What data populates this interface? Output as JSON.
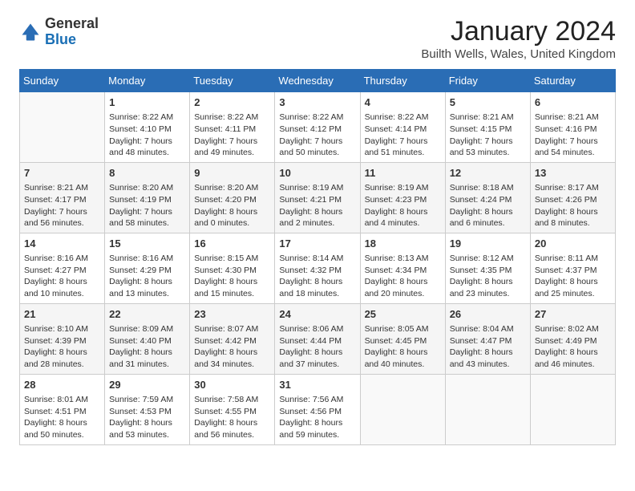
{
  "logo": {
    "general": "General",
    "blue": "Blue"
  },
  "header": {
    "title": "January 2024",
    "subtitle": "Builth Wells, Wales, United Kingdom"
  },
  "weekdays": [
    "Sunday",
    "Monday",
    "Tuesday",
    "Wednesday",
    "Thursday",
    "Friday",
    "Saturday"
  ],
  "weeks": [
    [
      {
        "day": "",
        "empty": true
      },
      {
        "day": "1",
        "sunrise": "Sunrise: 8:22 AM",
        "sunset": "Sunset: 4:10 PM",
        "daylight": "Daylight: 7 hours and 48 minutes."
      },
      {
        "day": "2",
        "sunrise": "Sunrise: 8:22 AM",
        "sunset": "Sunset: 4:11 PM",
        "daylight": "Daylight: 7 hours and 49 minutes."
      },
      {
        "day": "3",
        "sunrise": "Sunrise: 8:22 AM",
        "sunset": "Sunset: 4:12 PM",
        "daylight": "Daylight: 7 hours and 50 minutes."
      },
      {
        "day": "4",
        "sunrise": "Sunrise: 8:22 AM",
        "sunset": "Sunset: 4:14 PM",
        "daylight": "Daylight: 7 hours and 51 minutes."
      },
      {
        "day": "5",
        "sunrise": "Sunrise: 8:21 AM",
        "sunset": "Sunset: 4:15 PM",
        "daylight": "Daylight: 7 hours and 53 minutes."
      },
      {
        "day": "6",
        "sunrise": "Sunrise: 8:21 AM",
        "sunset": "Sunset: 4:16 PM",
        "daylight": "Daylight: 7 hours and 54 minutes."
      }
    ],
    [
      {
        "day": "7",
        "sunrise": "Sunrise: 8:21 AM",
        "sunset": "Sunset: 4:17 PM",
        "daylight": "Daylight: 7 hours and 56 minutes."
      },
      {
        "day": "8",
        "sunrise": "Sunrise: 8:20 AM",
        "sunset": "Sunset: 4:19 PM",
        "daylight": "Daylight: 7 hours and 58 minutes."
      },
      {
        "day": "9",
        "sunrise": "Sunrise: 8:20 AM",
        "sunset": "Sunset: 4:20 PM",
        "daylight": "Daylight: 8 hours and 0 minutes."
      },
      {
        "day": "10",
        "sunrise": "Sunrise: 8:19 AM",
        "sunset": "Sunset: 4:21 PM",
        "daylight": "Daylight: 8 hours and 2 minutes."
      },
      {
        "day": "11",
        "sunrise": "Sunrise: 8:19 AM",
        "sunset": "Sunset: 4:23 PM",
        "daylight": "Daylight: 8 hours and 4 minutes."
      },
      {
        "day": "12",
        "sunrise": "Sunrise: 8:18 AM",
        "sunset": "Sunset: 4:24 PM",
        "daylight": "Daylight: 8 hours and 6 minutes."
      },
      {
        "day": "13",
        "sunrise": "Sunrise: 8:17 AM",
        "sunset": "Sunset: 4:26 PM",
        "daylight": "Daylight: 8 hours and 8 minutes."
      }
    ],
    [
      {
        "day": "14",
        "sunrise": "Sunrise: 8:16 AM",
        "sunset": "Sunset: 4:27 PM",
        "daylight": "Daylight: 8 hours and 10 minutes."
      },
      {
        "day": "15",
        "sunrise": "Sunrise: 8:16 AM",
        "sunset": "Sunset: 4:29 PM",
        "daylight": "Daylight: 8 hours and 13 minutes."
      },
      {
        "day": "16",
        "sunrise": "Sunrise: 8:15 AM",
        "sunset": "Sunset: 4:30 PM",
        "daylight": "Daylight: 8 hours and 15 minutes."
      },
      {
        "day": "17",
        "sunrise": "Sunrise: 8:14 AM",
        "sunset": "Sunset: 4:32 PM",
        "daylight": "Daylight: 8 hours and 18 minutes."
      },
      {
        "day": "18",
        "sunrise": "Sunrise: 8:13 AM",
        "sunset": "Sunset: 4:34 PM",
        "daylight": "Daylight: 8 hours and 20 minutes."
      },
      {
        "day": "19",
        "sunrise": "Sunrise: 8:12 AM",
        "sunset": "Sunset: 4:35 PM",
        "daylight": "Daylight: 8 hours and 23 minutes."
      },
      {
        "day": "20",
        "sunrise": "Sunrise: 8:11 AM",
        "sunset": "Sunset: 4:37 PM",
        "daylight": "Daylight: 8 hours and 25 minutes."
      }
    ],
    [
      {
        "day": "21",
        "sunrise": "Sunrise: 8:10 AM",
        "sunset": "Sunset: 4:39 PM",
        "daylight": "Daylight: 8 hours and 28 minutes."
      },
      {
        "day": "22",
        "sunrise": "Sunrise: 8:09 AM",
        "sunset": "Sunset: 4:40 PM",
        "daylight": "Daylight: 8 hours and 31 minutes."
      },
      {
        "day": "23",
        "sunrise": "Sunrise: 8:07 AM",
        "sunset": "Sunset: 4:42 PM",
        "daylight": "Daylight: 8 hours and 34 minutes."
      },
      {
        "day": "24",
        "sunrise": "Sunrise: 8:06 AM",
        "sunset": "Sunset: 4:44 PM",
        "daylight": "Daylight: 8 hours and 37 minutes."
      },
      {
        "day": "25",
        "sunrise": "Sunrise: 8:05 AM",
        "sunset": "Sunset: 4:45 PM",
        "daylight": "Daylight: 8 hours and 40 minutes."
      },
      {
        "day": "26",
        "sunrise": "Sunrise: 8:04 AM",
        "sunset": "Sunset: 4:47 PM",
        "daylight": "Daylight: 8 hours and 43 minutes."
      },
      {
        "day": "27",
        "sunrise": "Sunrise: 8:02 AM",
        "sunset": "Sunset: 4:49 PM",
        "daylight": "Daylight: 8 hours and 46 minutes."
      }
    ],
    [
      {
        "day": "28",
        "sunrise": "Sunrise: 8:01 AM",
        "sunset": "Sunset: 4:51 PM",
        "daylight": "Daylight: 8 hours and 50 minutes."
      },
      {
        "day": "29",
        "sunrise": "Sunrise: 7:59 AM",
        "sunset": "Sunset: 4:53 PM",
        "daylight": "Daylight: 8 hours and 53 minutes."
      },
      {
        "day": "30",
        "sunrise": "Sunrise: 7:58 AM",
        "sunset": "Sunset: 4:55 PM",
        "daylight": "Daylight: 8 hours and 56 minutes."
      },
      {
        "day": "31",
        "sunrise": "Sunrise: 7:56 AM",
        "sunset": "Sunset: 4:56 PM",
        "daylight": "Daylight: 8 hours and 59 minutes."
      },
      {
        "day": "",
        "empty": true
      },
      {
        "day": "",
        "empty": true
      },
      {
        "day": "",
        "empty": true
      }
    ]
  ]
}
